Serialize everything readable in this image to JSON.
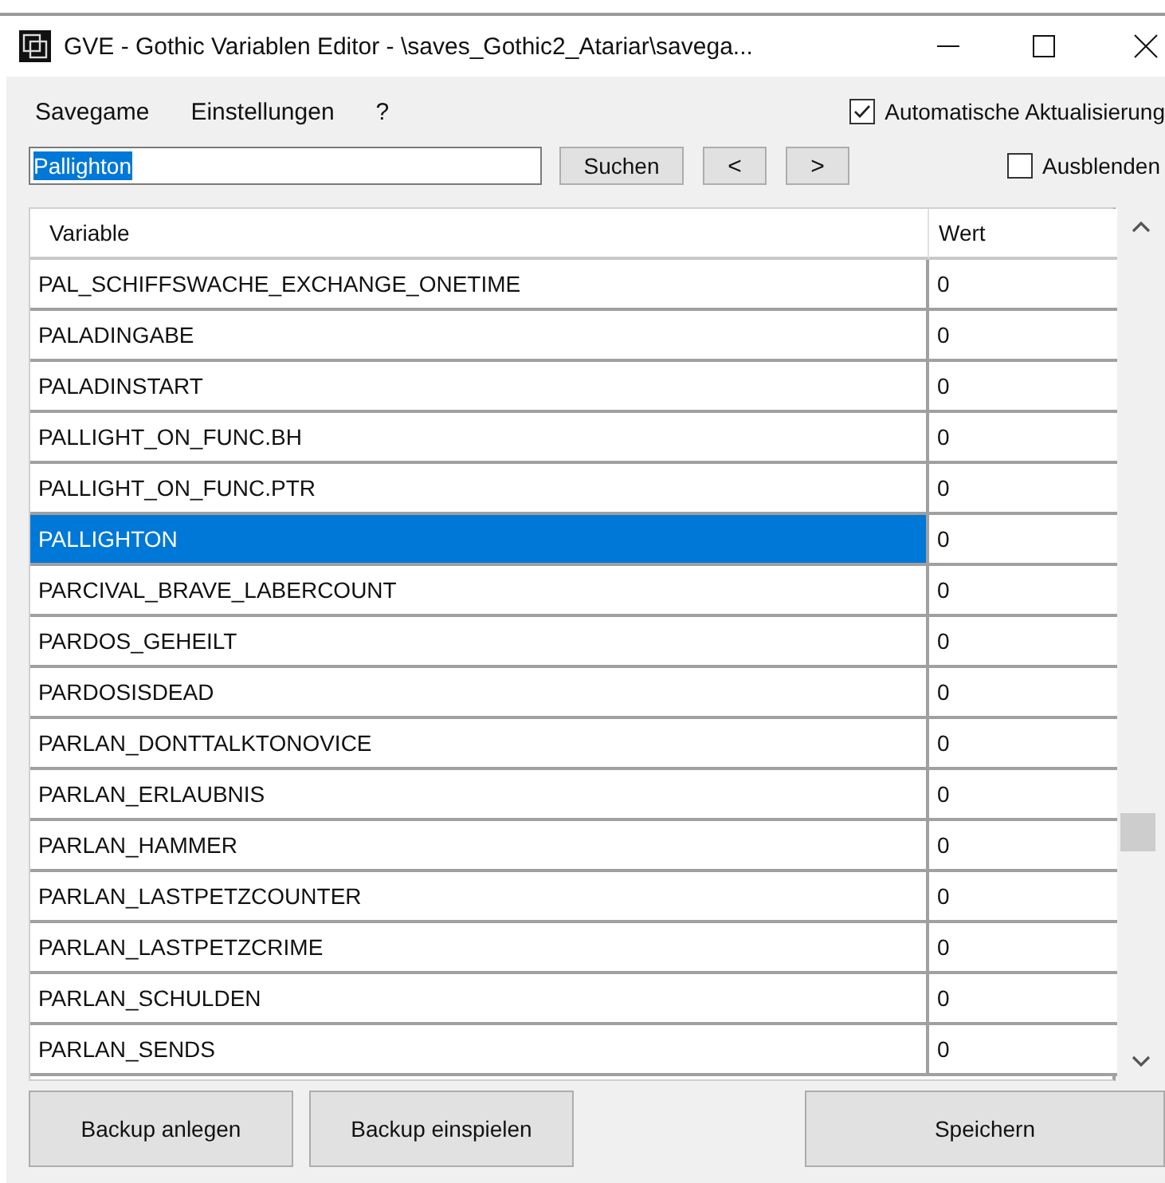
{
  "window": {
    "title": "GVE - Gothic Variablen Editor - \\saves_Gothic2_Atariar\\savega..."
  },
  "menu": [
    "Savegame",
    "Einstellungen",
    "?"
  ],
  "auto_update": {
    "label": "Automatische Aktualisierung",
    "checked": true
  },
  "search": {
    "value": "Pallighton",
    "button": "Suchen",
    "prev": "<",
    "next": ">"
  },
  "hide": {
    "label": "Ausblenden",
    "checked": false
  },
  "table": {
    "columns": [
      "Variable",
      "Wert"
    ],
    "rows": [
      {
        "variable": "PAL_SCHIFFSWACHE_EXCHANGE_ONETIME",
        "value": "0",
        "selected": false
      },
      {
        "variable": "PALADINGABE",
        "value": "0",
        "selected": false
      },
      {
        "variable": "PALADINSTART",
        "value": "0",
        "selected": false
      },
      {
        "variable": "PALLIGHT_ON_FUNC.BH",
        "value": "0",
        "selected": false
      },
      {
        "variable": "PALLIGHT_ON_FUNC.PTR",
        "value": "0",
        "selected": false
      },
      {
        "variable": "PALLIGHTON",
        "value": "0",
        "selected": true
      },
      {
        "variable": "PARCIVAL_BRAVE_LABERCOUNT",
        "value": "0",
        "selected": false
      },
      {
        "variable": "PARDOS_GEHEILT",
        "value": "0",
        "selected": false
      },
      {
        "variable": "PARDOSISDEAD",
        "value": "0",
        "selected": false
      },
      {
        "variable": "PARLAN_DONTTALKTONOVICE",
        "value": "0",
        "selected": false
      },
      {
        "variable": "PARLAN_ERLAUBNIS",
        "value": "0",
        "selected": false
      },
      {
        "variable": "PARLAN_HAMMER",
        "value": "0",
        "selected": false
      },
      {
        "variable": "PARLAN_LASTPETZCOUNTER",
        "value": "0",
        "selected": false
      },
      {
        "variable": "PARLAN_LASTPETZCRIME",
        "value": "0",
        "selected": false
      },
      {
        "variable": "PARLAN_SCHULDEN",
        "value": "0",
        "selected": false
      },
      {
        "variable": "PARLAN_SENDS",
        "value": "0",
        "selected": false
      }
    ]
  },
  "buttons": [
    "Backup anlegen",
    "Backup einspielen",
    "Speichern"
  ]
}
